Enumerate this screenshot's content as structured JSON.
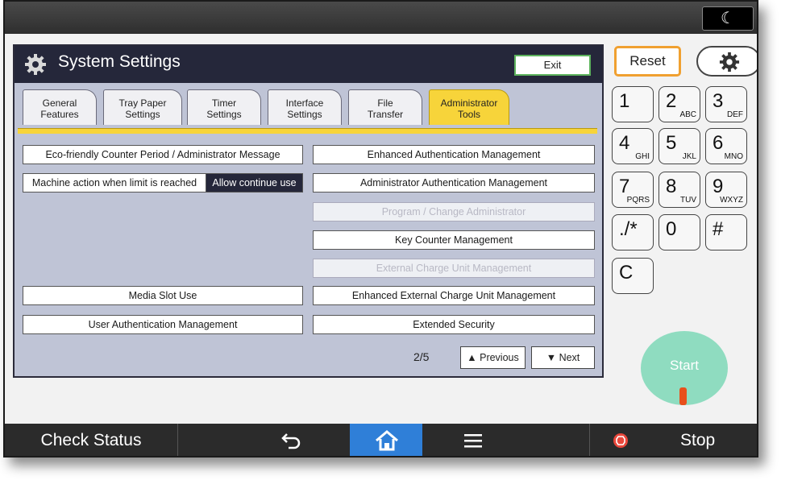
{
  "topbar": {
    "mode_icon": "moon-icon",
    "mode_glyph": "☾"
  },
  "panel": {
    "title": "System Settings",
    "exit_label": "Exit",
    "tabs": [
      {
        "line1": "General",
        "line2": "Features"
      },
      {
        "line1": "Tray Paper",
        "line2": "Settings"
      },
      {
        "line1": "Timer",
        "line2": "Settings"
      },
      {
        "line1": "Interface",
        "line2": "Settings"
      },
      {
        "line1": "File",
        "line2": "Transfer"
      },
      {
        "line1": "Administrator",
        "line2": "Tools"
      }
    ],
    "active_tab": "Administrator Tools",
    "left_items": {
      "eco": "Eco-friendly Counter Period / Administrator Message",
      "machine_action": "Machine action when limit is reached",
      "machine_action_value": "Allow continue use",
      "media_slot": "Media Slot Use",
      "user_auth": "User Authentication Management"
    },
    "right_items": {
      "enhanced_auth": "Enhanced Authentication Management",
      "admin_auth": "Administrator Authentication Management",
      "program_admin": "Program / Change Administrator",
      "key_counter": "Key Counter Management",
      "external_charge": "External Charge Unit Management",
      "enhanced_external": "Enhanced External Charge Unit Management",
      "extended_security": "Extended Security"
    },
    "pagination": {
      "indicator": "2/5",
      "previous": "Previous",
      "next": "Next"
    }
  },
  "side": {
    "reset_label": "Reset",
    "keys": [
      {
        "main": "1",
        "sub": ""
      },
      {
        "main": "2",
        "sub": "ABC"
      },
      {
        "main": "3",
        "sub": "DEF"
      },
      {
        "main": "4",
        "sub": "GHI"
      },
      {
        "main": "5",
        "sub": "JKL"
      },
      {
        "main": "6",
        "sub": "MNO"
      },
      {
        "main": "7",
        "sub": "PQRS"
      },
      {
        "main": "8",
        "sub": "TUV"
      },
      {
        "main": "9",
        "sub": "WXYZ"
      },
      {
        "main": "./*",
        "sub": ""
      },
      {
        "main": "0",
        "sub": ""
      },
      {
        "main": "#",
        "sub": ""
      },
      {
        "main": "C",
        "sub": ""
      }
    ],
    "start_label": "Start"
  },
  "bottombar": {
    "check_status": "Check Status",
    "stop_label": "Stop"
  },
  "colors": {
    "accent_tab": "#f7d43a",
    "home": "#2f7fd8",
    "start": "#8fdcc0",
    "reset_border": "#f0a030"
  }
}
